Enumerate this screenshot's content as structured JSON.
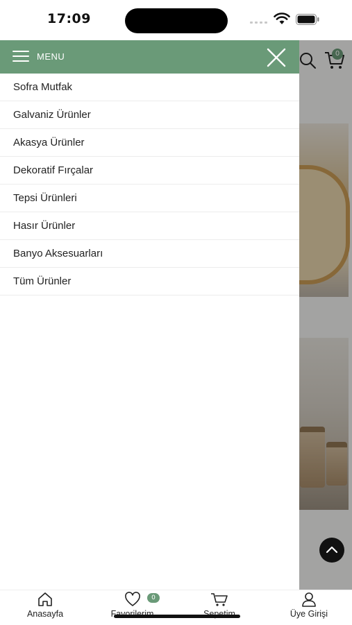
{
  "status_bar": {
    "time": "17:09"
  },
  "background": {
    "cart_count": "0"
  },
  "menu": {
    "title": "MENU",
    "items": [
      {
        "label": "Sofra Mutfak"
      },
      {
        "label": "Galvaniz Ürünler"
      },
      {
        "label": "Akasya Ürünler"
      },
      {
        "label": "Dekoratif Fırçalar"
      },
      {
        "label": "Tepsi Ürünleri"
      },
      {
        "label": "Hasır Ürünler"
      },
      {
        "label": "Banyo Aksesuarları"
      },
      {
        "label": "Tüm Ürünler"
      }
    ]
  },
  "tab_bar": {
    "home_label": "Anasayfa",
    "favorites_label": "Favorilerim",
    "favorites_count": "0",
    "cart_label": "Sepetim",
    "account_label": "Üye Girişi"
  },
  "colors": {
    "accent": "#6a9a78",
    "overlay": "#000000"
  }
}
